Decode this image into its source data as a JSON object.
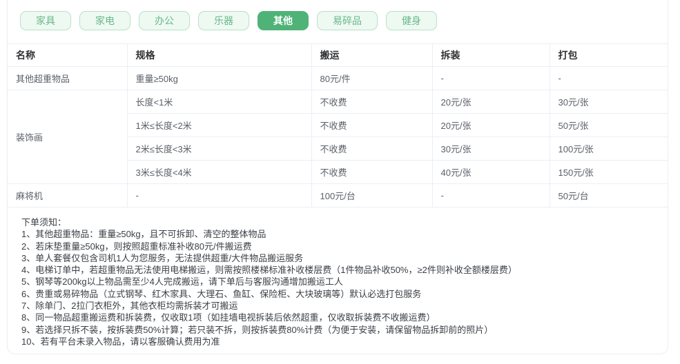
{
  "tabs": [
    {
      "label": "家具",
      "selected": false
    },
    {
      "label": "家电",
      "selected": false
    },
    {
      "label": "办公",
      "selected": false
    },
    {
      "label": "乐器",
      "selected": false
    },
    {
      "label": "其他",
      "selected": true
    },
    {
      "label": "易碎品",
      "selected": false
    },
    {
      "label": "健身",
      "selected": false
    }
  ],
  "table": {
    "headers": [
      "名称",
      "规格",
      "搬运",
      "拆装",
      "打包"
    ],
    "groups": [
      {
        "name": "其他超重物品",
        "rows": [
          [
            "重量≥50kg",
            "80元/件",
            "-",
            "-"
          ]
        ]
      },
      {
        "name": "装饰画",
        "rows": [
          [
            "长度<1米",
            "不收费",
            "20元/张",
            "30元/张"
          ],
          [
            "1米≤长度<2米",
            "不收费",
            "20元/张",
            "50元/张"
          ],
          [
            "2米≤长度<3米",
            "不收费",
            "30元/张",
            "100元/张"
          ],
          [
            "3米≤长度<4米",
            "不收费",
            "40元/张",
            "150元/张"
          ]
        ]
      },
      {
        "name": "麻将机",
        "rows": [
          [
            "-",
            "100元/台",
            "-",
            "50元/台"
          ]
        ]
      }
    ]
  },
  "notes": {
    "title": "下单须知：",
    "items": [
      "1、其他超重物品：重量≥50kg，且不可拆卸、清空的整体物品",
      "2、若床垫重量≥50kg，则按照超重标准补收80元/件搬运费",
      "3、单人套餐仅包含司机1人为您服务，无法提供超重/大件物品搬运服务",
      "4、电梯订单中，若超重物品无法使用电梯搬运，则需按照楼梯标准补收楼层费（1件物品补收50%，≥2件则补收全额楼层费）",
      "5、钢琴等200kg以上物品需至少4人完成搬运，请下单后与客服沟通增加搬运工人",
      "6、贵重或易碎物品（立式钢琴、红木家具、大理石、鱼缸、保险柜、大块玻璃等）默认必选打包服务",
      "7、除单门、2拉门衣柜外，其他衣柜均需拆装才可搬运",
      "8、同一物品超重搬运费和拆装费，仅收取1项（如挂墙电视拆装后依然超重，仅收取拆装费不收搬运费）",
      "9、若选择只拆不装，按拆装费50%计算；若只装不拆，则按拆装费80%计费（为便于安装，请保留物品拆卸前的照片）",
      "10、若有平台未录入物品，请以客服确认费用为准"
    ]
  },
  "colors": {
    "tab_selected_bg": "#4fb377",
    "tab_unselected_bg": "#eef9f2",
    "tab_unselected_border": "#b7e1c8",
    "tab_unselected_text": "#67b889",
    "table_border": "#ebeef5",
    "header_text": "#303133",
    "cell_text": "#5a6068"
  }
}
